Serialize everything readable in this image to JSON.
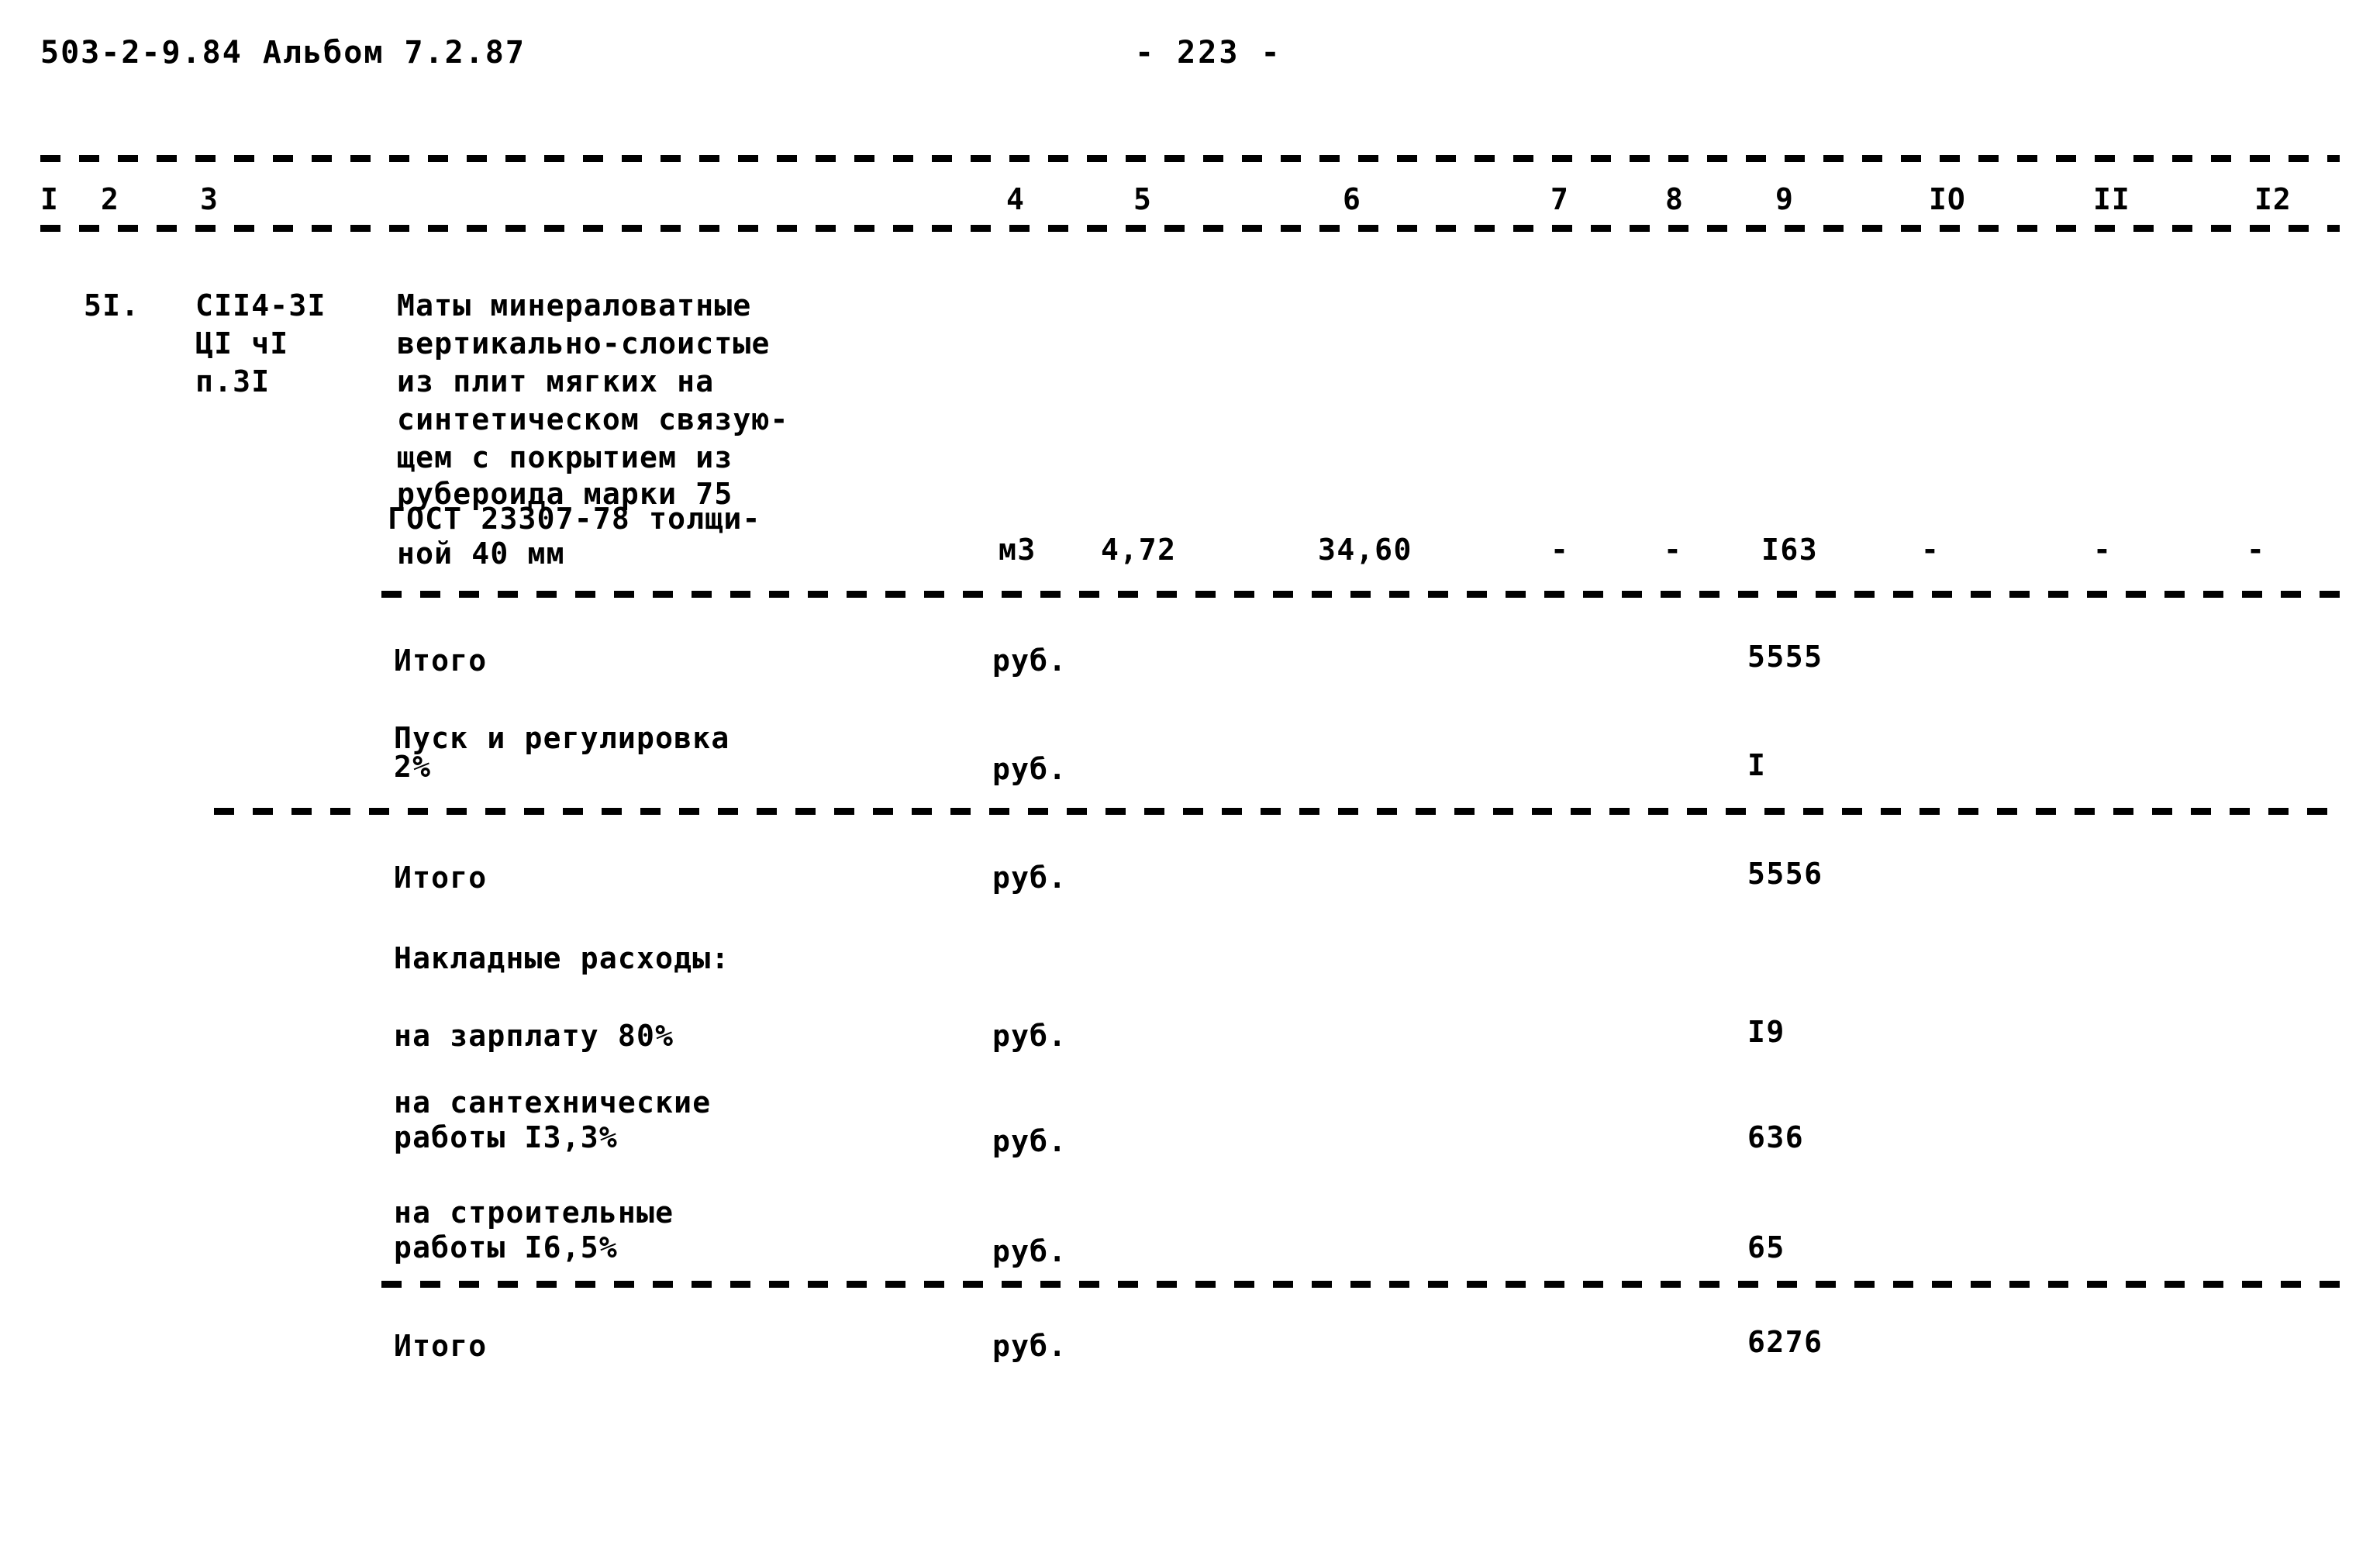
{
  "header": {
    "doc_code": "503-2-9.84 Альбом 7.2.87",
    "page_number": "- 223 -"
  },
  "table": {
    "column_headers": [
      "I",
      "2",
      "3",
      "4",
      "5",
      "6",
      "7",
      "8",
      "9",
      "IO",
      "II",
      "I2"
    ],
    "item": {
      "number": "5I.",
      "code_lines": [
        "СII4-3I",
        "ЦI чI",
        "п.3I"
      ],
      "description_lines": [
        "Маты минераловатные",
        "вертикально-слоистые",
        "из плит мягких на",
        "синтетическом связую-",
        "щем с покрытием из",
        "рубероида марки 75",
        "ГОСТ 23307-78 толщи-",
        "ной 40 мм"
      ],
      "unit": "м3",
      "col5": "4,72",
      "col6": "34,60",
      "col7": "-",
      "col8": "-",
      "col9": "I63",
      "col10": "-",
      "col11": "-",
      "col12": "-"
    },
    "summary_rows": [
      {
        "label_lines": [
          "Итого"
        ],
        "unit": "руб.",
        "value": "5555"
      },
      {
        "label_lines": [
          "Пуск и регулировка",
          "2%"
        ],
        "unit": "руб.",
        "value": "I"
      },
      {
        "label_lines": [
          "Итого"
        ],
        "unit": "руб.",
        "value": "5556"
      },
      {
        "label_lines": [
          "Накладные расходы:"
        ],
        "unit": "",
        "value": ""
      },
      {
        "label_lines": [
          "на зарплату 80%"
        ],
        "unit": "руб.",
        "value": "I9"
      },
      {
        "label_lines": [
          "на сантехнические",
          "работы I3,3%"
        ],
        "unit": "руб.",
        "value": "636"
      },
      {
        "label_lines": [
          "на строительные",
          "работы I6,5%"
        ],
        "unit": "руб.",
        "value": "65"
      },
      {
        "label_lines": [
          "Итого"
        ],
        "unit": "руб.",
        "value": "6276"
      }
    ]
  }
}
